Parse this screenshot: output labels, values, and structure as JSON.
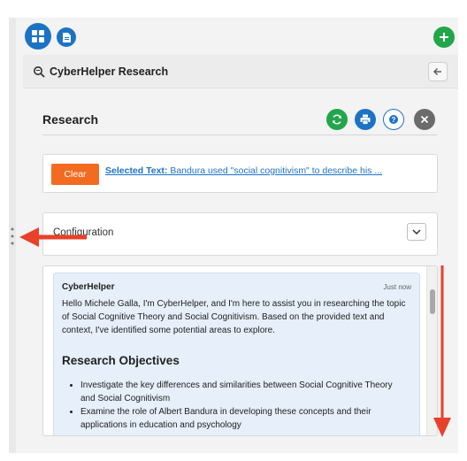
{
  "app": {
    "header_title": "CyberHelper Research"
  },
  "toolbar_icons": [
    "grid-icon",
    "document-icon",
    "plus-icon"
  ],
  "research": {
    "title": "Research",
    "actions": [
      "refresh-icon",
      "print-icon",
      "help-icon",
      "close-icon"
    ]
  },
  "selection": {
    "clear_label": "Clear",
    "prefix": "Selected Text:",
    "text": " Bandura used \"social cognitivism\" to describe his ..."
  },
  "configuration": {
    "label": "Configuration"
  },
  "chat": {
    "sender": "CyberHelper",
    "time": "Just now",
    "body": "Hello Michele Galla, I'm CyberHelper, and I'm here to assist you in researching the topic of Social Cognitive Theory and Social Cognitivism. Based on the provided text and context, I've identified some potential areas to explore.",
    "heading": "Research Objectives",
    "objectives": [
      "Investigate the key differences and similarities between Social Cognitive Theory and Social Cognitivism",
      "Examine the role of Albert Bandura in developing these concepts and their applications in education and psychology"
    ]
  },
  "colors": {
    "primary_blue": "#1c73c4",
    "green": "#21a64a",
    "orange": "#f26b21",
    "annotation_red": "#e8412a"
  }
}
